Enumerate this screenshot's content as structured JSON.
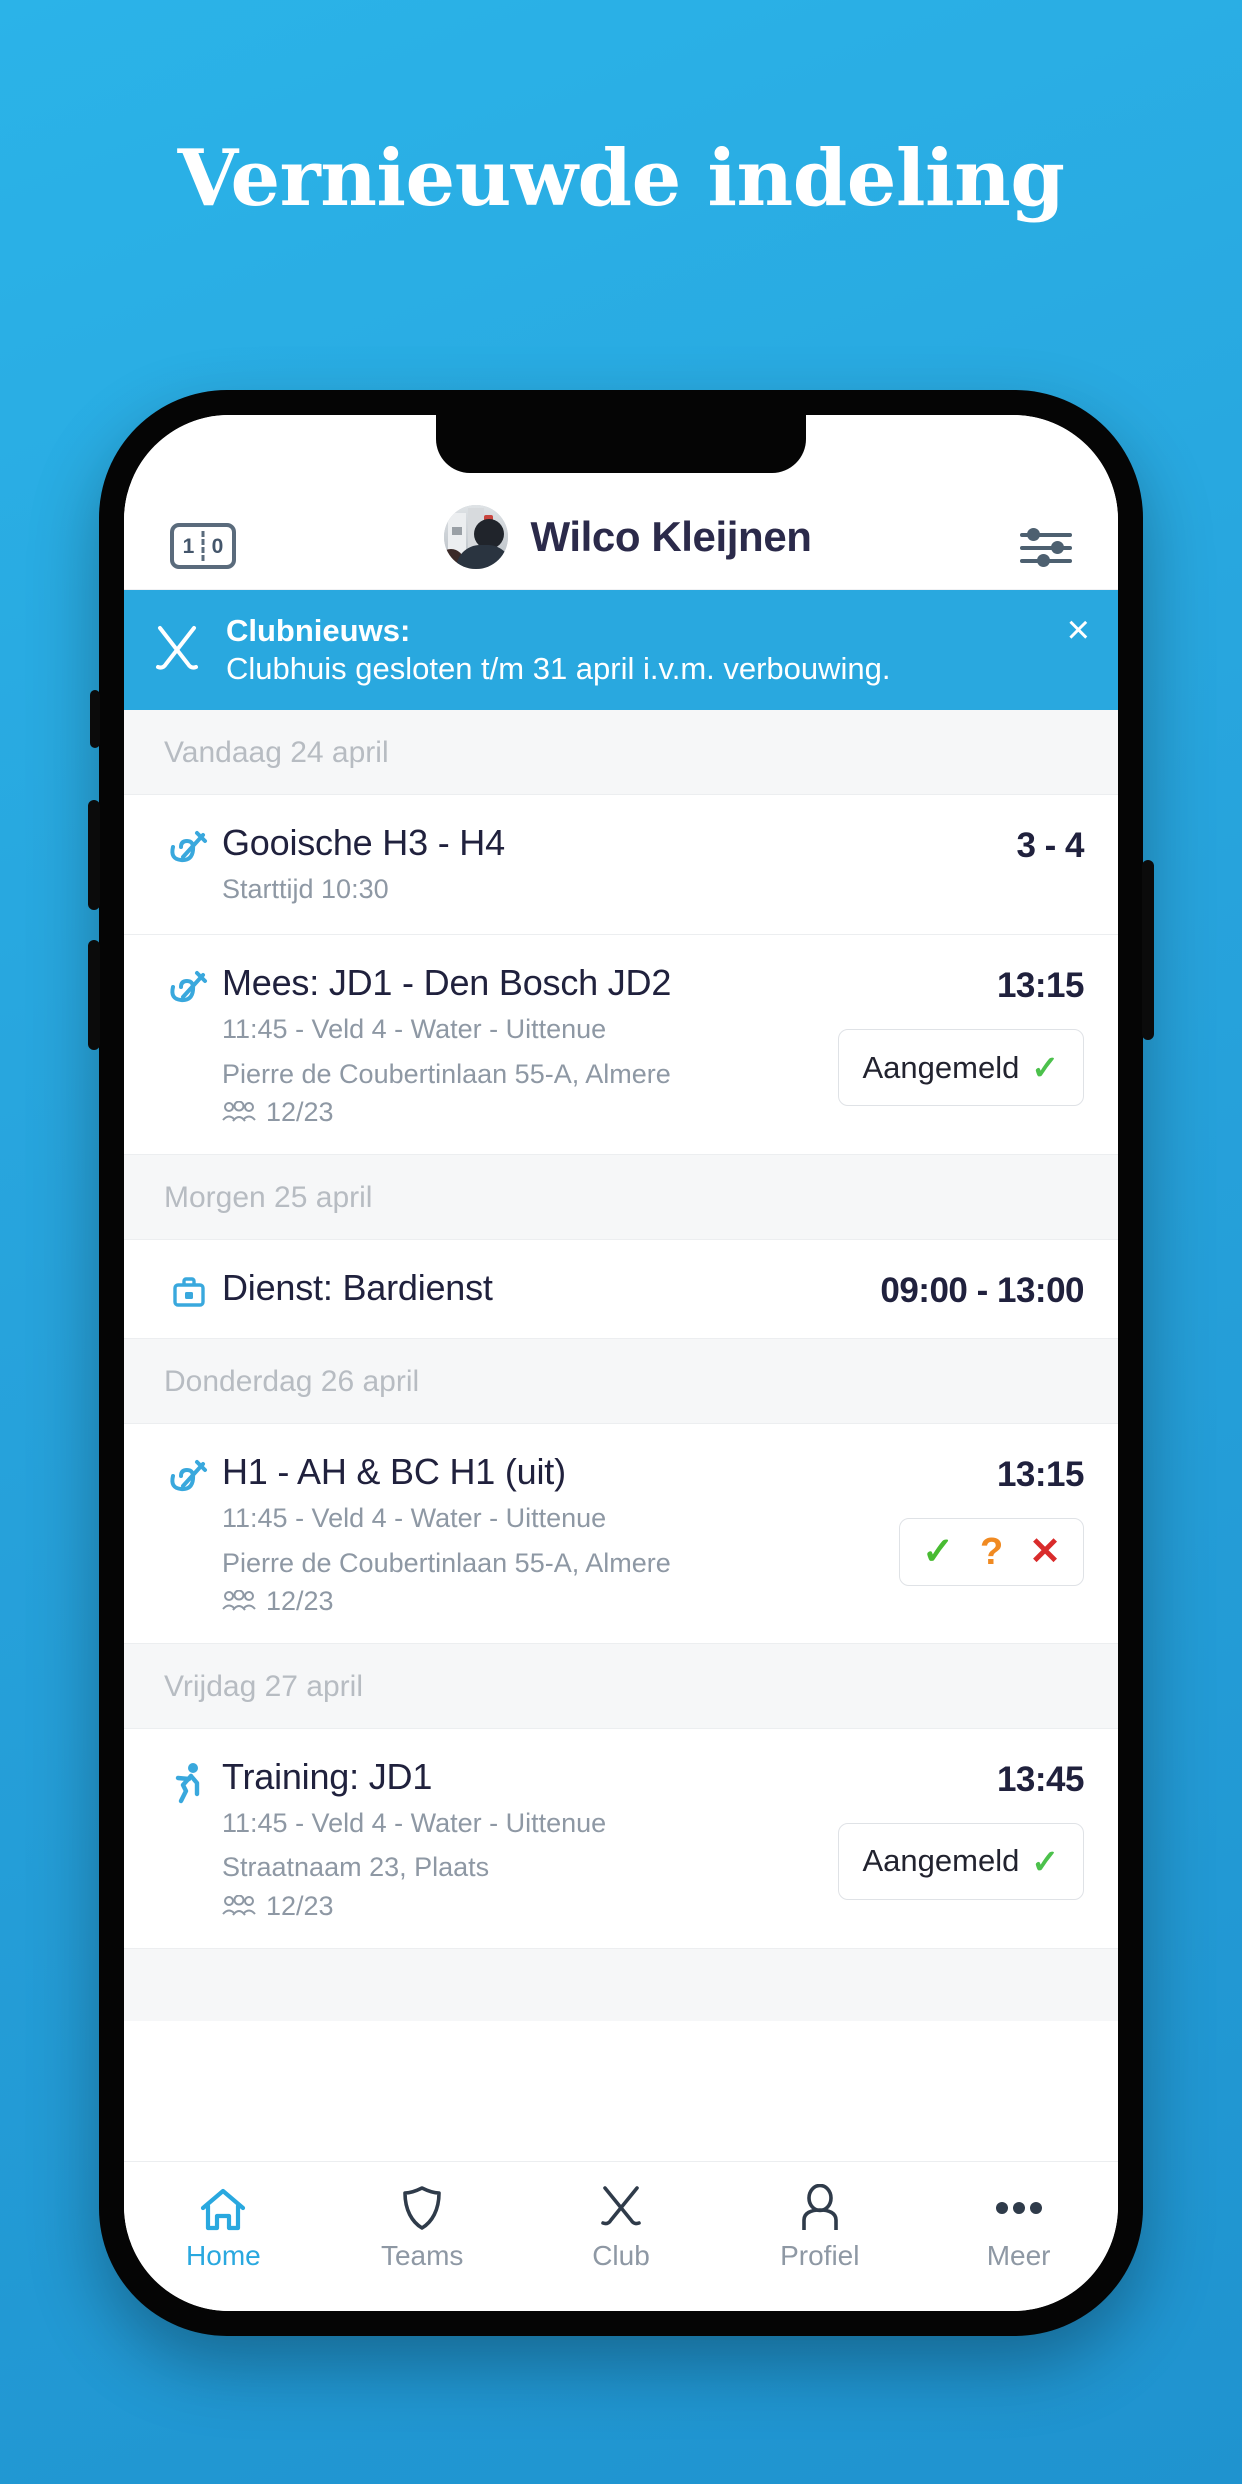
{
  "poster": {
    "headline": "Vernieuwde indeling",
    "background_color": "#29a8df"
  },
  "app": {
    "accent_color": "#29a8df",
    "header": {
      "score_icon": {
        "name": "scoreboard-icon",
        "left": "1",
        "right": "0"
      },
      "user_name": "Wilco Kleijnen",
      "avatar_name": "user-avatar",
      "settings_icon": "sliders-icon"
    },
    "banner": {
      "icon": "hockey-sticks-icon",
      "title": "Clubnieuws:",
      "message": "Clubhuis gesloten t/m 31 april i.v.m. verbouwing.",
      "close_label": "×",
      "background_color": "#29a8df"
    },
    "sections": [
      {
        "day_label": "Vandaag 24 april",
        "events": [
          {
            "icon": "hockey-sticks-icon",
            "title": "Gooische H3 - H4",
            "sub_lines": [
              "Starttijd 10:30"
            ],
            "attendance": null,
            "right_value": "3 - 4",
            "action": null
          },
          {
            "icon": "hockey-sticks-icon",
            "title": "Mees: JD1 - Den Bosch JD2",
            "sub_lines": [
              "11:45 - Veld 4 - Water - Uittenue",
              "Pierre de Coubertinlaan 55-A, Almere"
            ],
            "attendance": "12/23",
            "right_value": "13:15",
            "action": {
              "type": "status",
              "label": "Aangemeld",
              "tick": "✓"
            }
          }
        ]
      },
      {
        "day_label": "Morgen 25 april",
        "events": [
          {
            "icon": "briefcase-icon",
            "title": "Dienst: Bardienst",
            "sub_lines": [],
            "attendance": null,
            "right_value": "09:00 - 13:00",
            "action": null
          }
        ]
      },
      {
        "day_label": "Donderdag 26 april",
        "events": [
          {
            "icon": "hockey-sticks-icon",
            "title": "H1 - AH & BC H1 (uit)",
            "sub_lines": [
              "11:45 - Veld 4 - Water - Uittenue",
              "Pierre de Coubertinlaan 55-A, Almere"
            ],
            "attendance": "12/23",
            "right_value": "13:15",
            "action": {
              "type": "choices",
              "yes": "✓",
              "maybe": "?",
              "no": "✕",
              "yes_color": "#48bb32",
              "maybe_color": "#f08a22",
              "no_color": "#d92b2b"
            }
          }
        ]
      },
      {
        "day_label": "Vrijdag 27 april",
        "events": [
          {
            "icon": "running-icon",
            "title": "Training: JD1",
            "sub_lines": [
              "11:45 - Veld 4 - Water - Uittenue",
              "Straatnaam 23, Plaats"
            ],
            "attendance": "12/23",
            "right_value": "13:45",
            "action": {
              "type": "status",
              "label": "Aangemeld",
              "tick": "✓"
            }
          }
        ]
      }
    ],
    "tabbar": [
      {
        "label": "Home",
        "icon": "home-icon",
        "active": true
      },
      {
        "label": "Teams",
        "icon": "shield-icon",
        "active": false
      },
      {
        "label": "Club",
        "icon": "hockey-sticks-icon",
        "active": false
      },
      {
        "label": "Profiel",
        "icon": "person-icon",
        "active": false
      },
      {
        "label": "Meer",
        "icon": "ellipsis-icon",
        "active": false
      }
    ]
  }
}
